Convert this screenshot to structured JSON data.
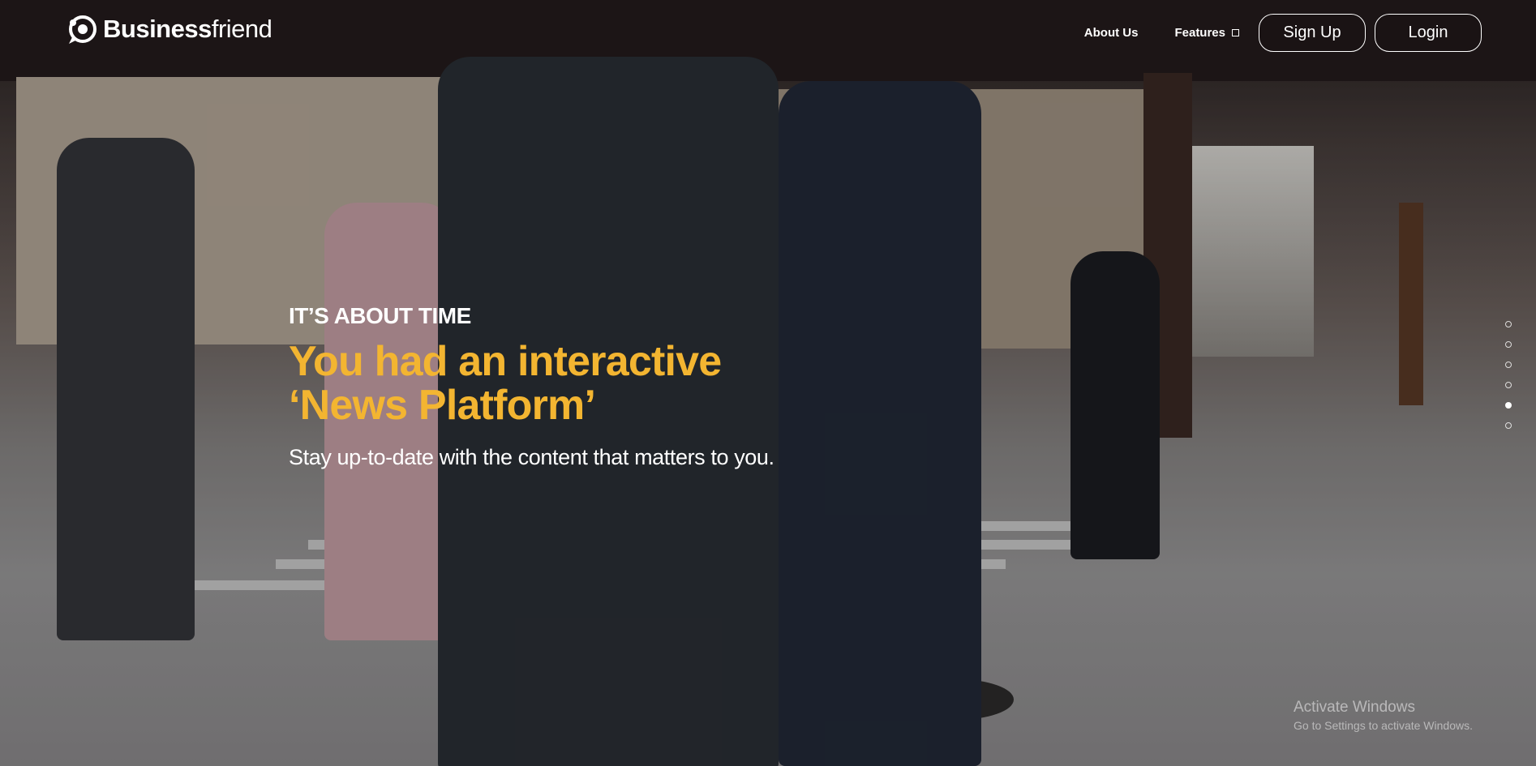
{
  "brand": {
    "name_bold": "Business",
    "name_light": "friend"
  },
  "nav": {
    "about": "About Us",
    "features": "Features",
    "signup": "Sign Up",
    "login": "Login"
  },
  "hero": {
    "eyebrow": "IT’S ABOUT TIME",
    "headline_line1": "You had an interactive",
    "headline_line2": "‘News Platform’",
    "subline": "Stay up-to-date with the content that matters to you."
  },
  "slider": {
    "count": 6,
    "active_index": 4
  },
  "watermark": {
    "title": "Activate Windows",
    "subtitle": "Go to Settings to activate Windows."
  },
  "colors": {
    "accent": "#f3b531",
    "text": "#ffffff"
  },
  "icons": {
    "logo": "speech-bubble-logo-icon",
    "features_dropdown": "dropdown-square-icon"
  }
}
